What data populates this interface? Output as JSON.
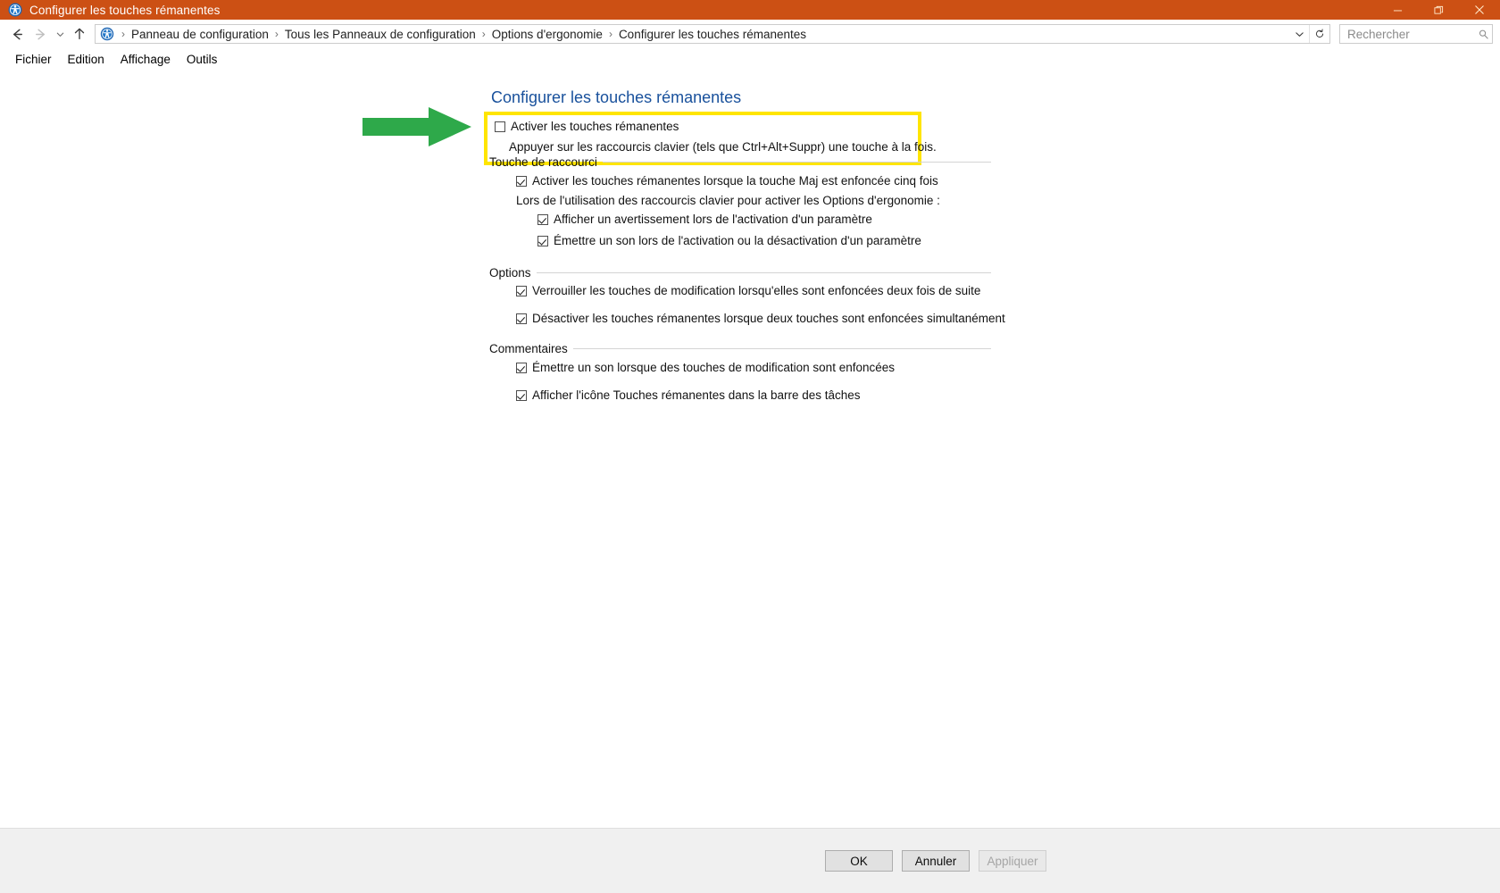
{
  "window": {
    "title": "Configurer les touches rémanentes",
    "icon": "ease-of-access-icon",
    "accent_color": "#cc5014",
    "controls": {
      "minimize": "minimize-icon",
      "maximize": "restore-icon",
      "close": "close-icon"
    }
  },
  "navbar": {
    "back": "back-arrow-icon",
    "forward": "forward-arrow-icon",
    "recent": "chevron-down-icon",
    "up": "up-arrow-icon",
    "breadcrumb_icon": "ease-of-access-icon",
    "breadcrumbs": [
      "Panneau de configuration",
      "Tous les Panneaux de configuration",
      "Options d'ergonomie",
      "Configurer les touches rémanentes"
    ],
    "separator": "›",
    "address_chevron": "chevron-down-icon",
    "refresh": "refresh-icon",
    "search": {
      "value": "",
      "placeholder": "Rechercher",
      "icon": "search-icon"
    }
  },
  "menubar": {
    "items": [
      "Fichier",
      "Edition",
      "Affichage",
      "Outils"
    ]
  },
  "page": {
    "title": "Configurer les touches rémanentes",
    "title_color": "#19519c",
    "highlight_color": "#ffe500",
    "arrow_color": "#2ea94a",
    "main_option": {
      "label": "Activer les touches rémanentes",
      "checked": false,
      "description": "Appuyer sur les raccourcis clavier (tels que Ctrl+Alt+Suppr) une touche à la fois."
    },
    "groups": [
      {
        "title": "Touche de raccourci",
        "items": [
          {
            "type": "checkbox",
            "label": "Activer les touches rémanentes lorsque la touche Maj est enfoncée cinq fois",
            "checked": true
          },
          {
            "type": "text",
            "label": "Lors de l'utilisation des raccourcis clavier pour activer les Options d'ergonomie :"
          },
          {
            "type": "checkbox",
            "label": "Afficher un avertissement lors de l'activation d'un paramètre",
            "checked": true
          },
          {
            "type": "checkbox",
            "label": "Émettre un son lors de l'activation ou la désactivation d'un paramètre",
            "checked": true
          }
        ]
      },
      {
        "title": "Options",
        "items": [
          {
            "type": "checkbox",
            "label": "Verrouiller les touches de modification lorsqu'elles sont enfoncées deux fois de suite",
            "checked": true
          },
          {
            "type": "checkbox",
            "label": "Désactiver les touches rémanentes lorsque deux touches sont enfoncées simultanément",
            "checked": true
          }
        ]
      },
      {
        "title": "Commentaires",
        "items": [
          {
            "type": "checkbox",
            "label": "Émettre un son lorsque des touches de modification sont enfoncées",
            "checked": true
          },
          {
            "type": "checkbox",
            "label": "Afficher l'icône Touches rémanentes dans la barre des tâches",
            "checked": true
          }
        ]
      }
    ]
  },
  "footer": {
    "buttons": [
      {
        "label": "OK",
        "disabled": false
      },
      {
        "label": "Annuler",
        "disabled": false
      },
      {
        "label": "Appliquer",
        "disabled": true
      }
    ]
  }
}
